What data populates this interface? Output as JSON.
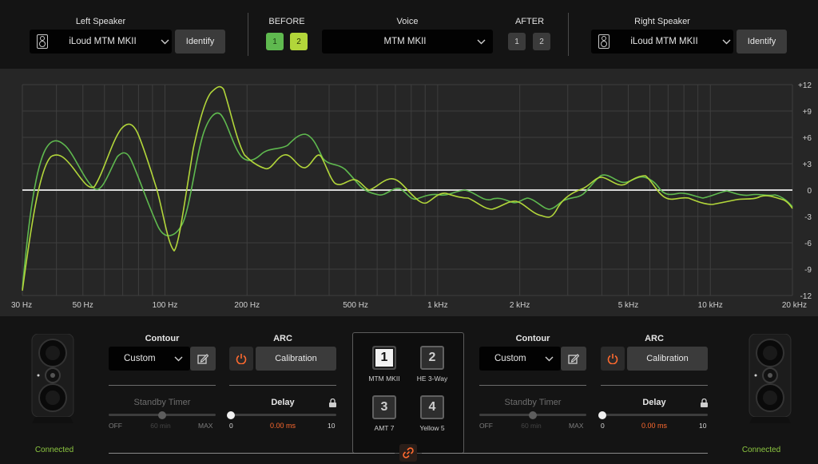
{
  "header": {
    "left_speaker": {
      "label": "Left Speaker",
      "value": "iLoud MTM MKII",
      "identify": "Identify"
    },
    "before": {
      "label": "BEFORE",
      "buttons": [
        "1",
        "2"
      ],
      "colors": [
        "#5fb94f",
        "#b2d63a"
      ]
    },
    "voice": {
      "label": "Voice",
      "value": "MTM MKII"
    },
    "after": {
      "label": "AFTER",
      "buttons": [
        "1",
        "2"
      ]
    },
    "right_speaker": {
      "label": "Right Speaker",
      "value": "iLoud MTM MKII",
      "identify": "Identify"
    }
  },
  "graph": {
    "x_ticks": [
      "30 Hz",
      "50 Hz",
      "100 Hz",
      "200 Hz",
      "500 Hz",
      "1 kHz",
      "2 kHz",
      "5 kHz",
      "10 kHz",
      "20 kHz"
    ],
    "y_ticks": [
      "+12",
      "+9",
      "+6",
      "+3",
      "0",
      "-3",
      "-6",
      "-9",
      "-12"
    ],
    "series_colors": [
      "#5fb94f",
      "#b2d63a"
    ]
  },
  "left_panel": {
    "contour": {
      "label": "Contour",
      "value": "Custom"
    },
    "arc": {
      "label": "ARC",
      "button": "Calibration"
    },
    "standby": {
      "label": "Standby Timer",
      "min": "OFF",
      "value": "60 min",
      "max": "MAX"
    },
    "delay": {
      "label": "Delay",
      "min": "0",
      "value": "0.00 ms",
      "max": "10"
    },
    "status": "Connected"
  },
  "voice_selector": {
    "slots": [
      {
        "num": "1",
        "label": "MTM MKII",
        "active": true
      },
      {
        "num": "2",
        "label": "HE 3-Way",
        "active": false
      },
      {
        "num": "3",
        "label": "AMT 7",
        "active": false
      },
      {
        "num": "4",
        "label": "Yellow 5",
        "active": false
      }
    ]
  },
  "right_panel": {
    "contour": {
      "label": "Contour",
      "value": "Custom"
    },
    "arc": {
      "label": "ARC",
      "button": "Calibration"
    },
    "standby": {
      "label": "Standby Timer",
      "min": "OFF",
      "value": "60 min",
      "max": "MAX"
    },
    "delay": {
      "label": "Delay",
      "min": "0",
      "value": "0.00 ms",
      "max": "10"
    },
    "status": "Connected"
  },
  "colors": {
    "accent": "#ff6a2f",
    "connected": "#8cc640"
  }
}
